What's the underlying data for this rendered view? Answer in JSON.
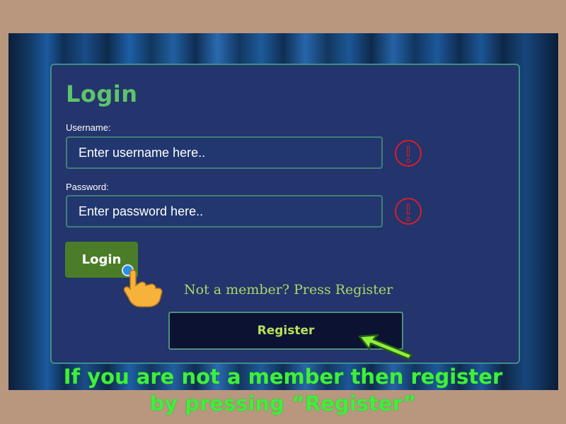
{
  "form": {
    "title": "Login",
    "username_label": "Username:",
    "username_placeholder": "Enter username here..",
    "password_label": "Password:",
    "password_placeholder": "Enter password here..",
    "login_button": "Login",
    "register_hint": "Not a member? Press Register",
    "register_button": "Register"
  },
  "caption": {
    "line1": "If you are not a member then register",
    "line2": "by pressing “Register”"
  },
  "icons": {
    "username_alert": "exclamation-circle-icon",
    "password_alert": "exclamation-circle-icon",
    "pointer": "pointing-hand-icon",
    "arrow": "arrow-icon"
  },
  "colors": {
    "accent_green": "#5ec46a",
    "login_button": "#4b7d28",
    "alert_red": "#d91e2a",
    "card": "#24346c",
    "caption_green": "#3ef03a"
  }
}
